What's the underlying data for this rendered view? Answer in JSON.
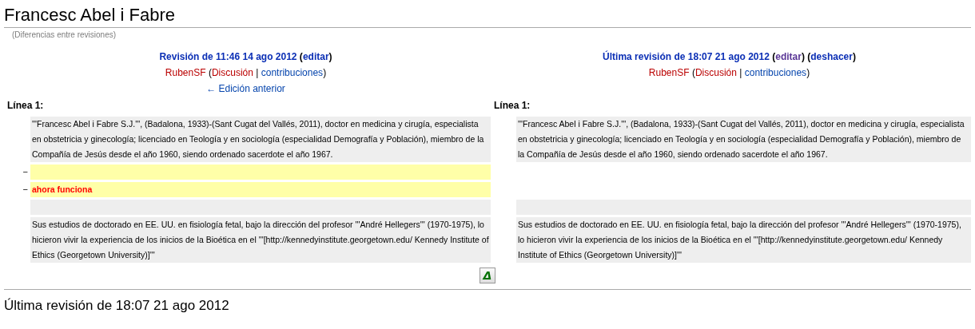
{
  "page_title": "Francesc Abel i Fabre",
  "subtitle": "(Diferencias entre revisiones)",
  "revisions": [
    {
      "lines": [
        [
          {
            "kind": "title",
            "text": "Revisión de 11:46 14 ago 2012"
          },
          {
            "kind": "punct",
            "text": " ("
          },
          {
            "kind": "action",
            "text": "editar",
            "visited": false
          },
          {
            "kind": "punct",
            "text": ")"
          }
        ],
        [
          {
            "kind": "user",
            "text": "RubenSF"
          },
          {
            "kind": "plain",
            "text": " ("
          },
          {
            "kind": "user",
            "text": "Discusión"
          },
          {
            "kind": "plain",
            "text": " | "
          },
          {
            "kind": "link",
            "text": "contribuciones"
          },
          {
            "kind": "plain",
            "text": ")"
          }
        ],
        [
          {
            "kind": "link",
            "text": "← Edición anterior"
          }
        ]
      ]
    },
    {
      "lines": [
        [
          {
            "kind": "title",
            "text": "Última revisión de 18:07 21 ago 2012"
          },
          {
            "kind": "punct",
            "text": " ("
          },
          {
            "kind": "action",
            "text": "editar",
            "visited": true
          },
          {
            "kind": "punct",
            "text": ") ("
          },
          {
            "kind": "action",
            "text": "deshacer",
            "visited": false
          },
          {
            "kind": "punct",
            "text": ")"
          }
        ],
        [
          {
            "kind": "user",
            "text": "RubenSF"
          },
          {
            "kind": "plain",
            "text": " ("
          },
          {
            "kind": "user",
            "text": "Discusión"
          },
          {
            "kind": "plain",
            "text": " | "
          },
          {
            "kind": "link",
            "text": "contribuciones"
          },
          {
            "kind": "plain",
            "text": ")"
          }
        ]
      ]
    }
  ],
  "line_headers": [
    "Línea 1:",
    "Línea 1:"
  ],
  "rows": [
    {
      "kind": "context",
      "left": "'''Francesc Abel i Fabre S.J.''', (Badalona, 1933)-(Sant Cugat del Vallés, 2011), doctor en medicina y cirugía, especialista en obstetricia y ginecología; licenciado en Teología y en sociología (especialidad Demografía y Población), miembro de la Compañía de Jesús desde el año 1960, siendo ordenado sacerdote el año 1967.",
      "right": "'''Francesc Abel i Fabre S.J.''', (Badalona, 1933)-(Sant Cugat del Vallés, 2011), doctor en medicina y cirugía, especialista en obstetricia y ginecología; licenciado en Teología y en sociología (especialidad Demografía y Población), miembro de la Compañía de Jesús desde el año 1960, siendo ordenado sacerdote el año 1967."
    },
    {
      "kind": "deleted",
      "marker": "−"
    },
    {
      "kind": "deleted",
      "marker": "−",
      "left": "ahora funciona"
    },
    {
      "kind": "blank"
    },
    {
      "kind": "context",
      "left": "Sus estudios de doctorado en EE. UU. en fisiología fetal, bajo la dirección del profesor '''André Hellegers''' (1970-1975), lo hicieron vivir la experiencia de los inicios de la Bioética en el '''[http://kennedyinstitute.georgetown.edu/ Kennedy Institute of Ethics (Georgetown University)]'''",
      "right": "Sus estudios de doctorado en EE. UU. en fisiología fetal, bajo la dirección del profesor '''André Hellegers''' (1970-1975), lo hicieron vivir la experiencia de los inicios de la Bioética en el '''[http://kennedyinstitute.georgetown.edu/ Kennedy Institute of Ethics (Georgetown University)]'''"
    }
  ],
  "delta_button": "Δ",
  "bottom_heading": "Última revisión de 18:07 21 ago 2012"
}
